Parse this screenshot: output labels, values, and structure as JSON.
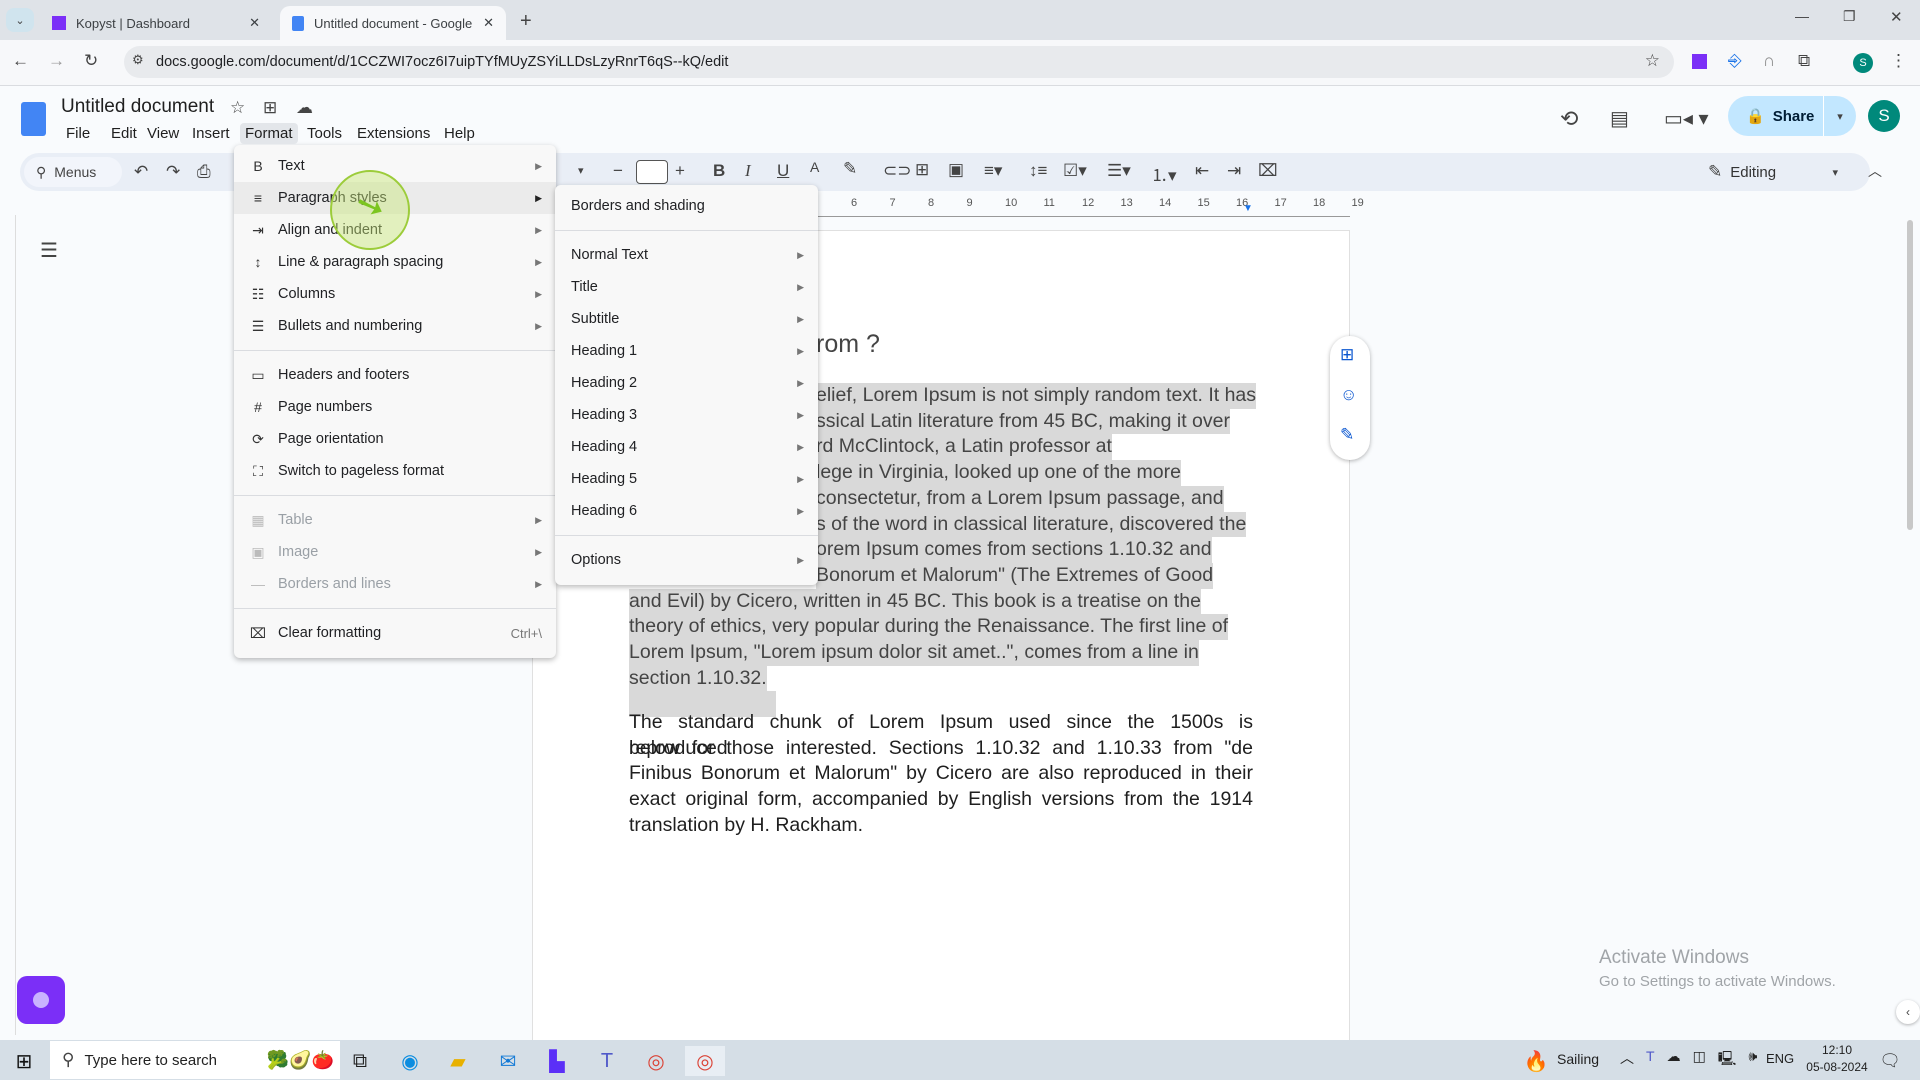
{
  "browser": {
    "tabs": [
      {
        "label": "Kopyst | Dashboard",
        "icon": "kopyst-icon"
      },
      {
        "label": "Untitled document - Google Do",
        "icon": "docs-icon",
        "active": true
      }
    ],
    "url": "docs.google.com/document/d/1CCZWI7ocz6I7uipTYfMUyZSYiLLDsLzyRnrT6qS--kQ/edit",
    "profile_initial": "S"
  },
  "docs": {
    "title": "Untitled document",
    "menubar": [
      "File",
      "Edit",
      "View",
      "Insert",
      "Format",
      "Tools",
      "Extensions",
      "Help"
    ],
    "active_menu": "Format",
    "share_label": "Share",
    "avatar_initial": "S",
    "toolbar": {
      "search_label": "Menus",
      "mode_label": "Editing",
      "font_size": ""
    },
    "ruler_ticks": [
      "6",
      "7",
      "8",
      "9",
      "10",
      "11",
      "12",
      "13",
      "14",
      "15",
      "16",
      "17",
      "18",
      "19"
    ],
    "accent": "#0b57d0"
  },
  "format_menu": {
    "items": [
      {
        "label": "Text",
        "icon": "B",
        "submenu": true
      },
      {
        "label": "Paragraph styles",
        "icon": "≡",
        "submenu": true,
        "selected": true
      },
      {
        "label": "Align and indent",
        "icon": "⇥",
        "submenu": true
      },
      {
        "label": "Line & paragraph spacing",
        "icon": "↕",
        "submenu": true
      },
      {
        "label": "Columns",
        "icon": "☷",
        "submenu": true
      },
      {
        "label": "Bullets and numbering",
        "icon": "☰",
        "submenu": true
      },
      {
        "divider": true
      },
      {
        "label": "Headers and footers",
        "icon": "▭"
      },
      {
        "label": "Page numbers",
        "icon": "#"
      },
      {
        "label": "Page orientation",
        "icon": "⟳"
      },
      {
        "label": "Switch to pageless format",
        "icon": "⛶"
      },
      {
        "divider": true
      },
      {
        "label": "Table",
        "icon": "▦",
        "submenu": true,
        "disabled": true
      },
      {
        "label": "Image",
        "icon": "▣",
        "submenu": true,
        "disabled": true
      },
      {
        "label": "Borders and lines",
        "icon": "—",
        "submenu": true,
        "disabled": true
      },
      {
        "divider": true
      },
      {
        "label": "Clear formatting",
        "icon": "⌧",
        "shortcut": "Ctrl+\\"
      }
    ]
  },
  "paragraph_styles_menu": {
    "items": [
      {
        "label": "Borders and shading"
      },
      {
        "divider": true
      },
      {
        "label": "Normal Text",
        "submenu": true
      },
      {
        "label": "Title",
        "submenu": true
      },
      {
        "label": "Subtitle",
        "submenu": true
      },
      {
        "label": "Heading 1",
        "submenu": true
      },
      {
        "label": "Heading 2",
        "submenu": true
      },
      {
        "label": "Heading 3",
        "submenu": true
      },
      {
        "label": "Heading 4",
        "submenu": true
      },
      {
        "label": "Heading 5",
        "submenu": true
      },
      {
        "label": "Heading 6",
        "submenu": true
      },
      {
        "divider": true
      },
      {
        "label": "Options",
        "submenu": true
      }
    ]
  },
  "document": {
    "heading_visible": "rom ?",
    "paragraph1_lines": [
      "elief, Lorem Ipsum is not simply random text. It has",
      "ssical Latin literature from 45 BC, making it over",
      "rd McClintock, a Latin professor at",
      "lege in Virginia, looked up one of the more",
      "consectetur, from a Lorem Ipsum passage, and",
      "s of the word in classical literature, discovered the",
      "orem Ipsum comes from sections 1.10.32 and",
      "Bonorum et Malorum\" (The Extremes of Good",
      "and Evil) by Cicero, written in 45 BC. This book is a treatise on the",
      "theory of ethics, very popular during the Renaissance. The first line of",
      "Lorem Ipsum, \"Lorem ipsum dolor sit amet..\", comes from a line in",
      "section 1.10.32."
    ],
    "paragraph2_lines": [
      "The standard chunk of Lorem Ipsum used since the 1500s is reproduced",
      "below for those interested. Sections 1.10.32 and 1.10.33 from \"de",
      "Finibus Bonorum et Malorum\" by Cicero are also reproduced in their",
      "exact original form, accompanied by English versions from the 1914",
      "translation by H. Rackham."
    ]
  },
  "watermark": {
    "title": "Activate Windows",
    "subtitle": "Go to Settings to activate Windows."
  },
  "taskbar": {
    "search_placeholder": "Type here to search",
    "weather": "Sailing",
    "language": "ENG",
    "time": "12:10",
    "date": "05-08-2024"
  }
}
